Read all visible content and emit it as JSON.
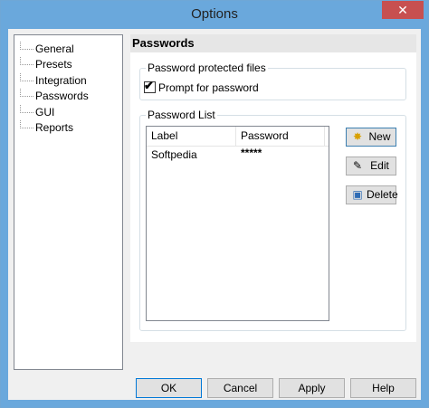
{
  "window": {
    "title": "Options",
    "close_symbol": "✕"
  },
  "tree": {
    "items": [
      {
        "label": "General"
      },
      {
        "label": "Presets"
      },
      {
        "label": "Integration"
      },
      {
        "label": "Passwords"
      },
      {
        "label": "GUI"
      },
      {
        "label": "Reports"
      }
    ],
    "selected": "Passwords"
  },
  "panel": {
    "heading": "Passwords",
    "protected_group": {
      "title": "Password protected files",
      "checkbox_label": "Prompt for password",
      "checked": true
    },
    "list_group": {
      "title": "Password List",
      "columns": [
        "Label",
        "Password"
      ],
      "rows": [
        [
          "Softpedia",
          "*****"
        ]
      ]
    },
    "buttons": {
      "new": {
        "label": "New",
        "icon": "new-star-icon"
      },
      "edit": {
        "label": "Edit",
        "icon": "pencil-icon"
      },
      "delete": {
        "label": "Delete",
        "icon": "delete-icon"
      }
    }
  },
  "footer": {
    "ok": "OK",
    "cancel": "Cancel",
    "apply": "Apply",
    "help": "Help"
  }
}
